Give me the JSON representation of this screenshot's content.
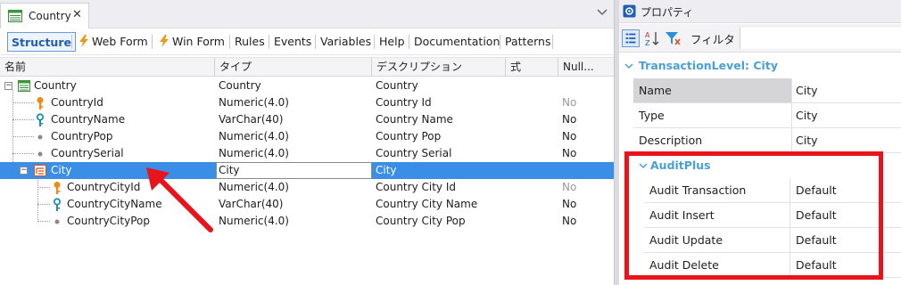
{
  "document_tab": {
    "title": "Country",
    "close": "✕"
  },
  "subtabs": [
    {
      "label": "Structure",
      "active": true
    },
    {
      "label": "Web Form",
      "icon": "bolt-icon"
    },
    {
      "label": "Win Form",
      "icon": "bolt-icon"
    },
    {
      "label": "Rules"
    },
    {
      "label": "Events"
    },
    {
      "label": "Variables"
    },
    {
      "label": "Help"
    },
    {
      "label": "Documentation"
    },
    {
      "label": "Patterns"
    }
  ],
  "grid": {
    "headers": [
      "名前",
      "タイプ",
      "デスクリプション",
      "式",
      "Null..."
    ],
    "rows": [
      {
        "name": "Country",
        "type": "Country",
        "desc": "Country",
        "null": "",
        "icon": "transaction-icon"
      },
      {
        "name": "CountryId",
        "type": "Numeric(4.0)",
        "desc": "Country Id",
        "null": "No",
        "icon": "primary-key-icon",
        "null_dim": true
      },
      {
        "name": "CountryName",
        "type": "VarChar(40)",
        "desc": "Country Name",
        "null": "No",
        "icon": "candidate-key-icon"
      },
      {
        "name": "CountryPop",
        "type": "Numeric(4.0)",
        "desc": "Country Pop",
        "null": "No",
        "icon": "attribute-dot-icon"
      },
      {
        "name": "CountrySerial",
        "type": "Numeric(4.0)",
        "desc": "Country Serial",
        "null": "No",
        "icon": "attribute-dot-icon"
      },
      {
        "name": "City",
        "type": "City",
        "desc": "City",
        "null": "",
        "icon": "level-icon",
        "selected": true
      },
      {
        "name": "CountryCityId",
        "type": "Numeric(4.0)",
        "desc": "Country City Id",
        "null": "No",
        "icon": "primary-key-icon",
        "null_dim": true
      },
      {
        "name": "CountryCityName",
        "type": "VarChar(40)",
        "desc": "Country City Name",
        "null": "No",
        "icon": "candidate-key-icon"
      },
      {
        "name": "CountryCityPop",
        "type": "Numeric(4.0)",
        "desc": "Country City Pop",
        "null": "No",
        "icon": "attribute-dot-icon"
      }
    ]
  },
  "properties": {
    "title": "プロパティ",
    "filter_label": "フィルタ",
    "filter_value": "",
    "section_title": "TransactionLevel: City",
    "rows": [
      {
        "name": "Name",
        "value": "City",
        "selected": true
      },
      {
        "name": "Type",
        "value": "City"
      },
      {
        "name": "Description",
        "value": "City"
      }
    ],
    "audit_group": "AuditPlus",
    "audit_rows": [
      {
        "name": "Audit Transaction",
        "value": "Default"
      },
      {
        "name": "Audit Insert",
        "value": "Default"
      },
      {
        "name": "Audit Update",
        "value": "Default"
      },
      {
        "name": "Audit Delete",
        "value": "Default"
      }
    ]
  },
  "colors": {
    "selection": "#3b8ee6",
    "section_title": "#4a9fd8",
    "highlight_box": "#e8141b",
    "arrow": "#e8141b"
  }
}
